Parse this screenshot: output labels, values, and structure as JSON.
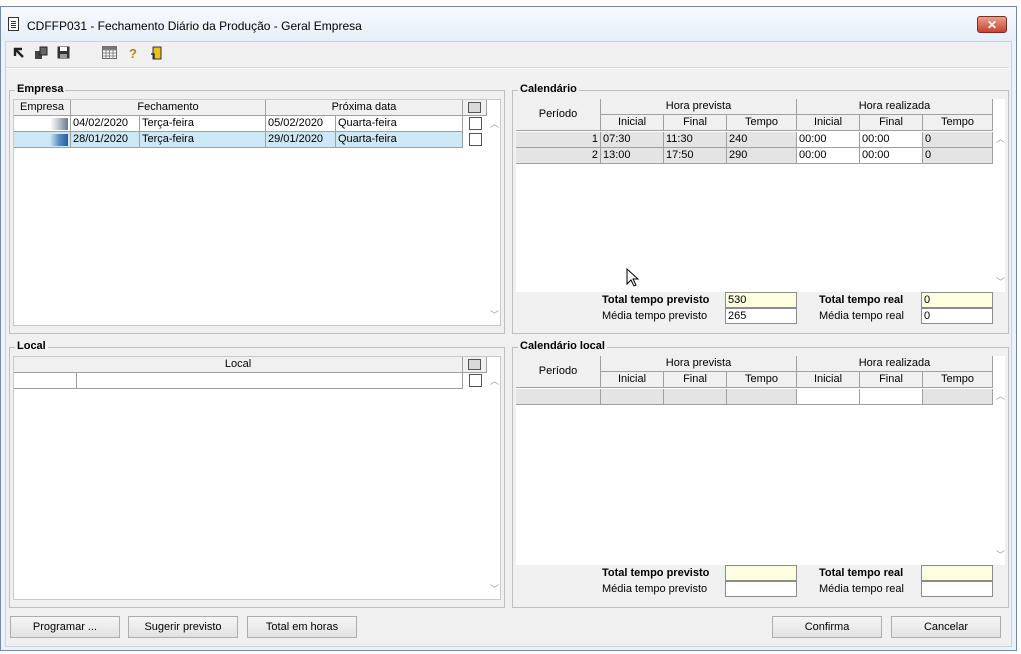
{
  "window": {
    "title": "CDFFP031 - Fechamento Diário da Produção - Geral Empresa",
    "close_label": "✕"
  },
  "toolbar": {
    "icons": [
      "arrow-up-left-icon",
      "copy-icon",
      "save-icon",
      "calendar-grid-icon",
      "help-icon",
      "exit-door-icon"
    ]
  },
  "empresa": {
    "label": "Empresa",
    "columns": [
      "Empresa",
      "Fechamento",
      "Próxima data"
    ],
    "rows": [
      {
        "empresa": "",
        "fechamento_data": "04/02/2020",
        "fechamento_dia": "Terça-feira",
        "proxima_data": "05/02/2020",
        "proxima_dia": "Quarta-feira",
        "selected": false
      },
      {
        "empresa": "",
        "fechamento_data": "28/01/2020",
        "fechamento_dia": "Terça-feira",
        "proxima_data": "29/01/2020",
        "proxima_dia": "Quarta-feira",
        "selected": true
      }
    ]
  },
  "calendario": {
    "label": "Calendário",
    "col_periodo": "Período",
    "group_prevista": "Hora prevista",
    "group_realizada": "Hora realizada",
    "sub_cols": [
      "Inicial",
      "Final",
      "Tempo",
      "Inicial",
      "Final",
      "Tempo"
    ],
    "rows": [
      {
        "periodo": "1",
        "prev_ini": "07:30",
        "prev_fim": "11:30",
        "prev_tempo": "240",
        "real_ini": "00:00",
        "real_fim": "00:00",
        "real_tempo": "0"
      },
      {
        "periodo": "2",
        "prev_ini": "13:00",
        "prev_fim": "17:50",
        "prev_tempo": "290",
        "real_ini": "00:00",
        "real_fim": "00:00",
        "real_tempo": "0"
      }
    ],
    "total_previsto_label": "Total tempo previsto",
    "total_previsto": "530",
    "total_real_label": "Total tempo real",
    "total_real": "0",
    "media_previsto_label": "Média tempo previsto",
    "media_previsto": "265",
    "media_real_label": "Média tempo real",
    "media_real": "0"
  },
  "local": {
    "label": "Local",
    "column": "Local"
  },
  "calendario_local": {
    "label": "Calendário local",
    "col_periodo": "Período",
    "group_prevista": "Hora prevista",
    "group_realizada": "Hora realizada",
    "sub_cols": [
      "Inicial",
      "Final",
      "Tempo",
      "Inicial",
      "Final",
      "Tempo"
    ],
    "total_previsto_label": "Total tempo previsto",
    "total_previsto": "",
    "total_real_label": "Total tempo real",
    "total_real": "",
    "media_previsto_label": "Média tempo previsto",
    "media_previsto": "",
    "media_real_label": "Média tempo real",
    "media_real": ""
  },
  "buttons": {
    "programar": "Programar ...",
    "sugerir": "Sugerir previsto",
    "total_horas": "Total em horas",
    "confirma": "Confirma",
    "cancelar": "Cancelar"
  },
  "colors": {
    "selected_row": "#cce8f4",
    "total_field": "#fdfde0",
    "close_button": "#c8422b"
  }
}
